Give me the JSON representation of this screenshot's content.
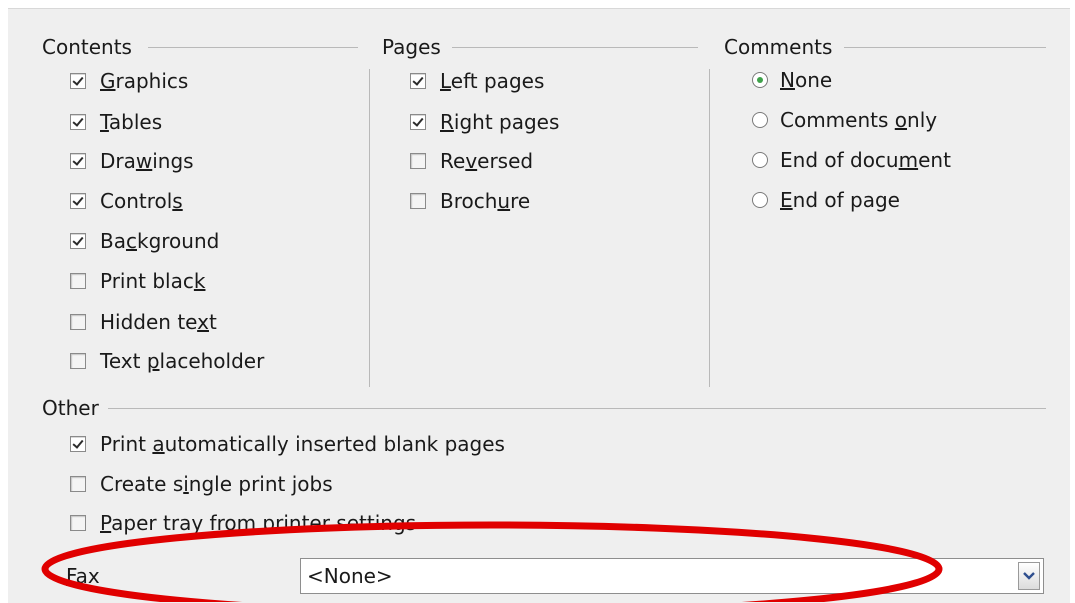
{
  "contents": {
    "title": "Contents",
    "items": [
      {
        "pre": "",
        "key": "G",
        "post": "raphics",
        "checked": true
      },
      {
        "pre": "",
        "key": "T",
        "post": "ables",
        "checked": true
      },
      {
        "pre": "Dra",
        "key": "w",
        "post": "ings",
        "checked": true
      },
      {
        "pre": "Control",
        "key": "s",
        "post": "",
        "checked": true
      },
      {
        "pre": "Ba",
        "key": "c",
        "post": "kground",
        "checked": true
      },
      {
        "pre": "Print blac",
        "key": "k",
        "post": "",
        "checked": false
      },
      {
        "pre": "Hidden te",
        "key": "x",
        "post": "t",
        "checked": false
      },
      {
        "pre": "Text ",
        "key": "p",
        "post": "laceholder",
        "checked": false
      }
    ]
  },
  "pages": {
    "title": "Pages",
    "items": [
      {
        "pre": "",
        "key": "L",
        "post": "eft pages",
        "checked": true
      },
      {
        "pre": "",
        "key": "R",
        "post": "ight pages",
        "checked": true
      },
      {
        "pre": "Re",
        "key": "v",
        "post": "ersed",
        "checked": false
      },
      {
        "pre": "Broch",
        "key": "u",
        "post": "re",
        "checked": false
      }
    ]
  },
  "comments": {
    "title": "Comments",
    "items": [
      {
        "pre": "",
        "key": "N",
        "post": "one",
        "selected": true
      },
      {
        "pre": "Comments ",
        "key": "o",
        "post": "nly",
        "selected": false
      },
      {
        "pre": "End of docu",
        "key": "m",
        "post": "ent",
        "selected": false
      },
      {
        "pre": "",
        "key": "E",
        "post": "nd of page",
        "selected": false
      }
    ]
  },
  "other": {
    "title": "Other",
    "items": [
      {
        "pre": "Print ",
        "key": "a",
        "post": "utomatically inserted blank pages",
        "checked": true
      },
      {
        "pre": "Create s",
        "key": "i",
        "post": "ngle print jobs",
        "checked": false
      },
      {
        "pre": "",
        "key": "P",
        "post": "aper tray from printer settings",
        "checked": false
      }
    ]
  },
  "fax": {
    "label_key": "F",
    "label_rest": "ax",
    "value": "<None>"
  },
  "colors": {
    "annotation": "#e00000",
    "radio_selected": "#3fa14a"
  }
}
